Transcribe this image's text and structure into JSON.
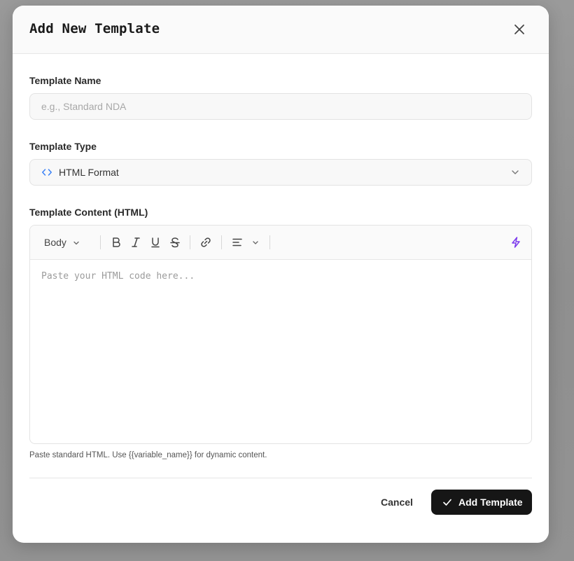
{
  "dialog": {
    "title": "Add New Template"
  },
  "fields": {
    "name": {
      "label": "Template Name",
      "placeholder": "e.g., Standard NDA",
      "value": ""
    },
    "type": {
      "label": "Template Type",
      "selected": "HTML Format"
    },
    "content": {
      "label": "Template Content (HTML)",
      "placeholder": "Paste your HTML code here...",
      "value": "",
      "helper": "Paste standard HTML. Use {{variable_name}} for dynamic content."
    }
  },
  "toolbar": {
    "style_select": "Body",
    "icons": [
      "bold-icon",
      "italic-icon",
      "underline-icon",
      "strikethrough-icon",
      "link-icon",
      "align-left-icon",
      "chevron-down-icon",
      "lightning-icon"
    ]
  },
  "actions": {
    "cancel": "Cancel",
    "submit": "Add Template"
  },
  "colors": {
    "accent_purple": "#7c3aed",
    "code_icon_blue": "#3b82f6",
    "primary_button": "#161616"
  }
}
